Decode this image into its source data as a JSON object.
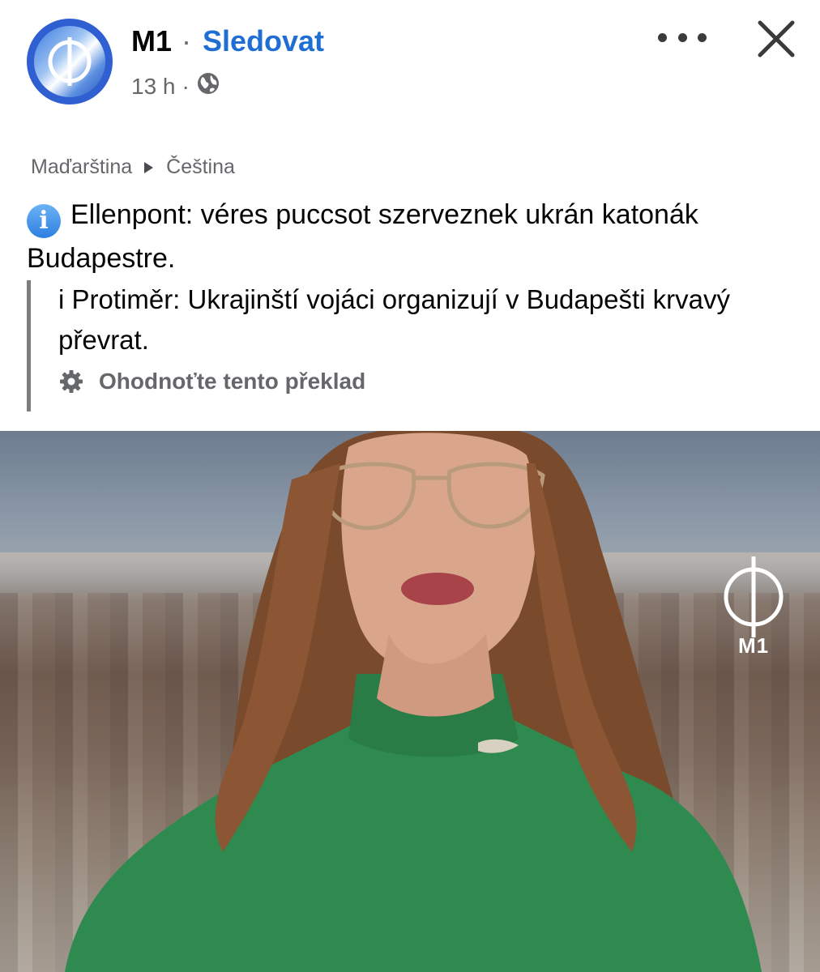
{
  "header": {
    "page_name": "M1",
    "separator": "·",
    "follow_label": "Sledovat",
    "time": "13 h",
    "meta_separator": "·",
    "audience_icon": "globe-icon",
    "more_icon": "more-options-icon",
    "close_icon": "close-icon"
  },
  "translation": {
    "source_language": "Maďarština",
    "target_language": "Čeština",
    "original_text": "Ellenpont: véres puccsot szerveznek ukrán katonák Budapestre.",
    "translated_text": "i Protiměr: Ukrajinští vojáci organizují v Budapešti krvavý převrat.",
    "rate_label": "Ohodnoťte tento překlad"
  },
  "media": {
    "channel_logo_text": "M1"
  },
  "colors": {
    "accent": "#1f6ed4",
    "secondary_text": "#65676b",
    "primary_text": "#050505"
  }
}
